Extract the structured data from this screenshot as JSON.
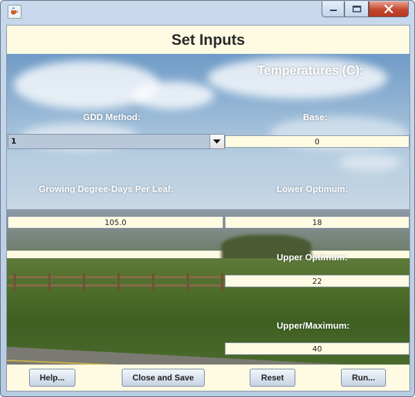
{
  "window": {
    "title": "",
    "app_icon": "java-cup-icon",
    "controls": [
      "minimize-icon",
      "maximize-icon",
      "close-icon"
    ]
  },
  "header": {
    "title": "Set Inputs"
  },
  "labels": {
    "temperatures": "Temperatures (C):",
    "gdd_method": "GDD Method:",
    "base": "Base:",
    "gdd_per_leaf": "Growing Degree-Days Per Leaf:",
    "lower_optimum": "Lower Optimum:",
    "upper_optimum": "Upper Optimum:",
    "upper_maximum": "Upper/Maximum:"
  },
  "inputs": {
    "gdd_method": "1",
    "base": "0",
    "gdd_per_leaf": "105.0",
    "lower_optimum": "18",
    "upper_optimum": "22",
    "upper_maximum": "40"
  },
  "buttons": {
    "help": "Help...",
    "close_and_save": "Close and Save",
    "reset": "Reset",
    "run": "Run..."
  },
  "colors": {
    "panel_bg": "#fffbe3",
    "combo_bg": "#b8c7da",
    "close_button": "#c3462c"
  }
}
